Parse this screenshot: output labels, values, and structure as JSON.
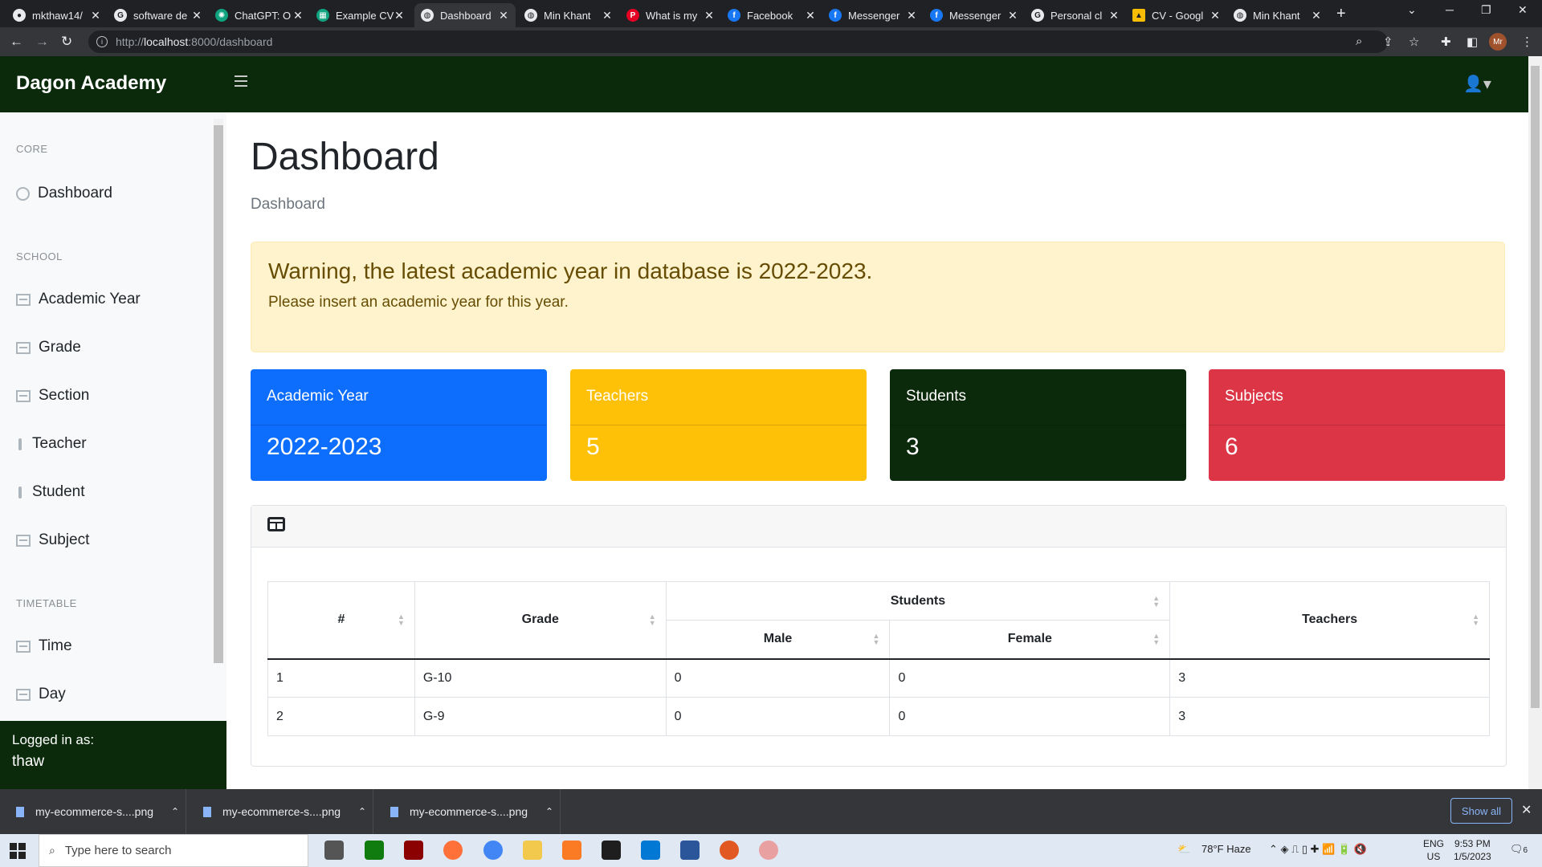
{
  "browser": {
    "tabs": [
      {
        "title": "mkthaw14/",
        "icon": "github-icon"
      },
      {
        "title": "software de",
        "icon": "google-icon"
      },
      {
        "title": "ChatGPT: O",
        "icon": "chatgpt-icon"
      },
      {
        "title": "Example CV",
        "icon": "sheets-icon"
      },
      {
        "title": "Dashboard",
        "icon": "globe-icon"
      },
      {
        "title": "Min Khant",
        "icon": "globe-icon"
      },
      {
        "title": "What is my",
        "icon": "pinterest-icon"
      },
      {
        "title": "Facebook",
        "icon": "facebook-icon"
      },
      {
        "title": "Messenger",
        "icon": "facebook-icon"
      },
      {
        "title": "Messenger",
        "icon": "facebook-icon"
      },
      {
        "title": "Personal cl",
        "icon": "google-icon"
      },
      {
        "title": "CV - Googl",
        "icon": "drive-icon"
      },
      {
        "title": "Min Khant",
        "icon": "globe-icon"
      }
    ],
    "url_scheme": "http://",
    "url_host": "localhost",
    "url_path": ":8000/dashboard",
    "profile_initials": "Mr"
  },
  "app": {
    "brand": "Dagon Academy",
    "colors": {
      "header": "#0b2a0b",
      "primary": "#0d6efd",
      "warning": "#ffc107",
      "dark": "#0b2a0b",
      "danger": "#dc3545"
    }
  },
  "sidebar": {
    "headings": {
      "core": "CORE",
      "school": "SCHOOL",
      "timetable": "TIMETABLE"
    },
    "items": [
      {
        "label": "Dashboard",
        "icon": "dashboard-icon"
      },
      {
        "label": "Academic Year",
        "icon": "table-icon"
      },
      {
        "label": "Grade",
        "icon": "table-icon"
      },
      {
        "label": "Section",
        "icon": "table-icon"
      },
      {
        "label": "Teacher",
        "icon": "person-icon"
      },
      {
        "label": "Student",
        "icon": "person-icon"
      },
      {
        "label": "Subject",
        "icon": "table-icon"
      },
      {
        "label": "Time",
        "icon": "table-icon"
      },
      {
        "label": "Day",
        "icon": "table-icon"
      }
    ],
    "footer": {
      "label": "Logged in as:",
      "user": "thaw"
    }
  },
  "main": {
    "title": "Dashboard",
    "breadcrumb": "Dashboard",
    "alert": {
      "heading": "Warning, the latest academic year in database is 2022-2023.",
      "text": "Please insert an academic year for this year."
    },
    "cards": [
      {
        "label": "Academic Year",
        "value": "2022-2023"
      },
      {
        "label": "Teachers",
        "value": "5"
      },
      {
        "label": "Students",
        "value": "3"
      },
      {
        "label": "Subjects",
        "value": "6"
      }
    ],
    "table": {
      "headers": {
        "num": "#",
        "grade": "Grade",
        "students": "Students",
        "male": "Male",
        "female": "Female",
        "teachers": "Teachers"
      },
      "rows": [
        {
          "num": "1",
          "grade": "G-10",
          "male": "0",
          "female": "0",
          "teachers": "3"
        },
        {
          "num": "2",
          "grade": "G-9",
          "male": "0",
          "female": "0",
          "teachers": "3"
        }
      ]
    }
  },
  "downloads": {
    "items": [
      "my-ecommerce-s....png",
      "my-ecommerce-s....png",
      "my-ecommerce-s....png"
    ],
    "show_all": "Show all"
  },
  "taskbar": {
    "search_placeholder": "Type here to search",
    "weather": "78°F  Haze",
    "lang": "ENG",
    "region": "US",
    "time": "9:53 PM",
    "date": "1/5/2023",
    "notifications": "6"
  }
}
